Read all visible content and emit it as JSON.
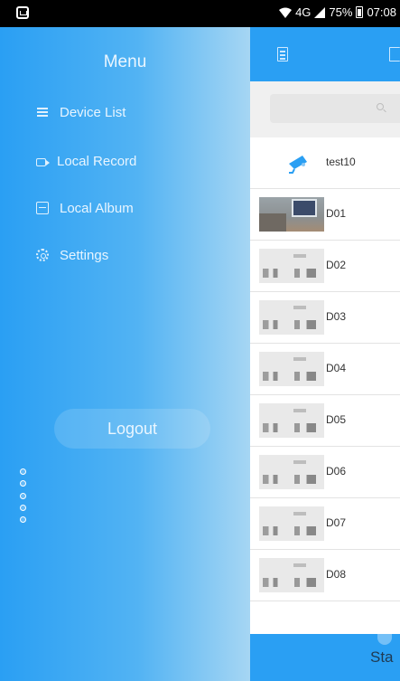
{
  "status_bar": {
    "network": "4G",
    "battery": "75%",
    "time": "07:08"
  },
  "drawer": {
    "title": "Menu",
    "items": [
      {
        "label": "Device List",
        "icon": "list-icon"
      },
      {
        "label": "Local Record",
        "icon": "record-icon"
      },
      {
        "label": "Local Album",
        "icon": "album-icon"
      },
      {
        "label": "Settings",
        "icon": "gear-icon"
      }
    ],
    "logout_label": "Logout"
  },
  "devices": [
    {
      "name": "test10",
      "type": "camera"
    },
    {
      "name": "D01",
      "type": "room"
    },
    {
      "name": "D02",
      "type": "sketch"
    },
    {
      "name": "D03",
      "type": "sketch"
    },
    {
      "name": "D04",
      "type": "sketch"
    },
    {
      "name": "D05",
      "type": "sketch"
    },
    {
      "name": "D06",
      "type": "sketch"
    },
    {
      "name": "D07",
      "type": "sketch"
    },
    {
      "name": "D08",
      "type": "sketch"
    }
  ],
  "bottom_bar": {
    "label": "Sta"
  },
  "colors": {
    "accent": "#2a9ff3",
    "drawer_end": "#a6d6f3"
  }
}
